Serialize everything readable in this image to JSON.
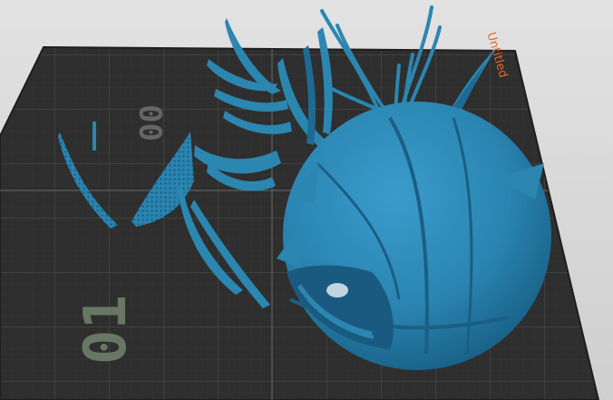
{
  "plate": {
    "title": "Untitled",
    "number_back": "00",
    "number_front": "01"
  },
  "colors": {
    "background": "#dadada",
    "plate": "#2f2f2f",
    "grid_major": "#4c4c4c",
    "grid_minor": "#3a3a3a",
    "model": "#2b86b0",
    "model_shade": "#1d6b93",
    "title": "#e2672e"
  },
  "icons": {
    "model": "3d-model-icon"
  }
}
